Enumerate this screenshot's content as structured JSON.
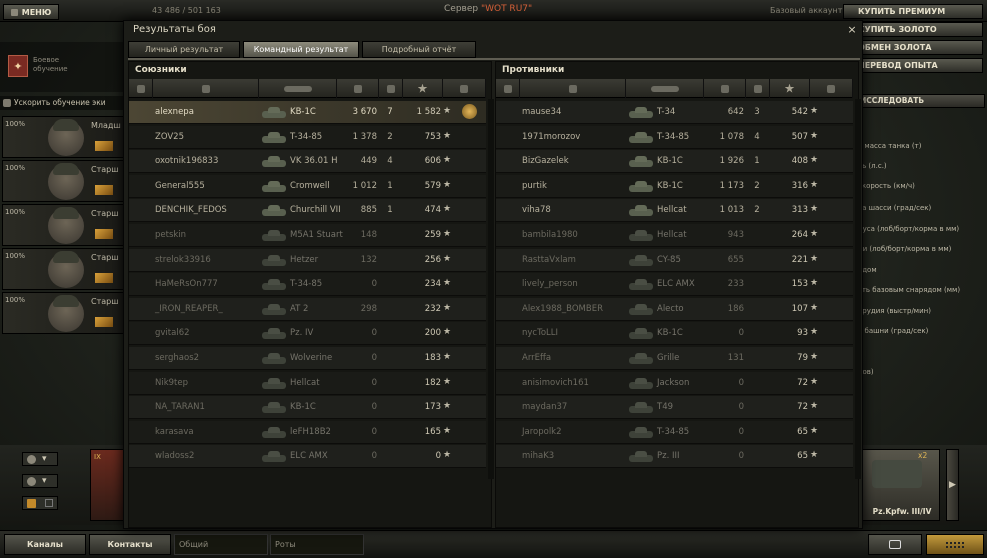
{
  "topbar": {
    "menu_label": "МЕНЮ",
    "stats": "43 486 / 501 163",
    "server_prefix": "Сервер ",
    "server_name": "\"WOT RU7\"",
    "account": "Базовый аккаунт",
    "buy_premium": "КУПИТЬ ПРЕМИУМ",
    "buy_gold": "КУПИТЬ ЗОЛОТО",
    "exchange_gold": "ОБМЕН ЗОЛОТА",
    "convert_xp": "ПЕРЕВОД ОПЫТА"
  },
  "training": {
    "title": "Боевое обучение",
    "accelerate": "Ускорить обучение эки"
  },
  "crew": [
    {
      "pct": "100%",
      "rank": "Младш"
    },
    {
      "pct": "100%",
      "rank": "Старш"
    },
    {
      "pct": "100%",
      "rank": "Старш"
    },
    {
      "pct": "100%",
      "rank": "Старш"
    },
    {
      "pct": "100%",
      "rank": "Старш"
    }
  ],
  "research_label": "ИССЛЕДОВАТЬ",
  "params": [
    "я масса танка (т)",
    "ть (л.с.)",
    "скорость (км/ч)",
    "та шасси (град/сек)",
    "пуса (лоб/борт/корма в мм)",
    "ни (лоб/борт/корма в мм)",
    "ядом",
    "сть базовым снарядом (мм)",
    "орудия (выстр/мин)",
    "а башни (град/сек)",
    "ров)"
  ],
  "carousel": {
    "tank_name": "Pz.Kpfw. III/IV",
    "tank_tier": "x2",
    "left_card_tier": "IX"
  },
  "bottom": {
    "channels": "Каналы",
    "contacts": "Контакты",
    "common": "Общий",
    "companies": "Роты"
  },
  "dialog": {
    "title": "Результаты боя",
    "close": "×",
    "tabs": [
      {
        "label": "Личный результат"
      },
      {
        "label": "Командный результат"
      },
      {
        "label": "Подробный отчёт"
      }
    ],
    "allies_title": "Союзники",
    "enemies_title": "Противники",
    "allies": [
      {
        "player": "alexnepa",
        "tank": "KB-1C",
        "damage": "3 670",
        "kills": "7",
        "xp": "1 582"
      },
      {
        "player": "ZOV25",
        "tank": "T-34-85",
        "damage": "1 378",
        "kills": "2",
        "xp": "753"
      },
      {
        "player": "oxotnik196833",
        "tank": "VK 36.01 H",
        "damage": "449",
        "kills": "4",
        "xp": "606"
      },
      {
        "player": "General555",
        "tank": "Cromwell",
        "damage": "1 012",
        "kills": "1",
        "xp": "579"
      },
      {
        "player": "DENCHIK_FEDOS",
        "tank": "Churchill VII",
        "damage": "885",
        "kills": "1",
        "xp": "474"
      },
      {
        "player": "petskin",
        "tank": "M5A1 Stuart",
        "damage": "148",
        "kills": "",
        "xp": "259"
      },
      {
        "player": "strelok33916",
        "tank": "Hetzer",
        "damage": "132",
        "kills": "",
        "xp": "256"
      },
      {
        "player": "HaMeRsOn777",
        "tank": "T-34-85",
        "damage": "0",
        "kills": "",
        "xp": "234"
      },
      {
        "player": "_IRON_REAPER_",
        "tank": "AT 2",
        "damage": "298",
        "kills": "",
        "xp": "232"
      },
      {
        "player": "gvital62",
        "tank": "Pz. IV",
        "damage": "0",
        "kills": "",
        "xp": "200"
      },
      {
        "player": "serghaos2",
        "tank": "Wolverine",
        "damage": "0",
        "kills": "",
        "xp": "183"
      },
      {
        "player": "Nik9tep",
        "tank": "Hellcat",
        "damage": "0",
        "kills": "",
        "xp": "182"
      },
      {
        "player": "NA_TARAN1",
        "tank": "KB-1C",
        "damage": "0",
        "kills": "",
        "xp": "173"
      },
      {
        "player": "karasava",
        "tank": "leFH18B2",
        "damage": "0",
        "kills": "",
        "xp": "165"
      },
      {
        "player": "wladoss2",
        "tank": "ELC AMX",
        "damage": "0",
        "kills": "",
        "xp": "0"
      }
    ],
    "enemies": [
      {
        "player": "mause34",
        "tank": "T-34",
        "damage": "642",
        "kills": "3",
        "xp": "542"
      },
      {
        "player": "1971morozov",
        "tank": "T-34-85",
        "damage": "1 078",
        "kills": "4",
        "xp": "507"
      },
      {
        "player": "BizGazelek",
        "tank": "KB-1C",
        "damage": "1 926",
        "kills": "1",
        "xp": "408"
      },
      {
        "player": "purtik",
        "tank": "KB-1C",
        "damage": "1 173",
        "kills": "2",
        "xp": "316"
      },
      {
        "player": "viha78",
        "tank": "Hellcat",
        "damage": "1 013",
        "kills": "2",
        "xp": "313"
      },
      {
        "player": "bambila1980",
        "tank": "Hellcat",
        "damage": "943",
        "kills": "",
        "xp": "264"
      },
      {
        "player": "RasttaVxlam",
        "tank": "CY-85",
        "damage": "655",
        "kills": "",
        "xp": "221"
      },
      {
        "player": "lively_person",
        "tank": "ELC AMX",
        "damage": "233",
        "kills": "",
        "xp": "153"
      },
      {
        "player": "Alex1988_BOMBER",
        "tank": "Alecto",
        "damage": "186",
        "kills": "",
        "xp": "107"
      },
      {
        "player": "nycToLLI",
        "tank": "KB-1C",
        "damage": "0",
        "kills": "",
        "xp": "93"
      },
      {
        "player": "ArrEffa",
        "tank": "Grille",
        "damage": "131",
        "kills": "",
        "xp": "79"
      },
      {
        "player": "anisimovich161",
        "tank": "Jackson",
        "damage": "0",
        "kills": "",
        "xp": "72"
      },
      {
        "player": "maydan37",
        "tank": "T49",
        "damage": "0",
        "kills": "",
        "xp": "72"
      },
      {
        "player": "Jaropolk2",
        "tank": "T-34-85",
        "damage": "0",
        "kills": "",
        "xp": "65"
      },
      {
        "player": "mihaK3",
        "tank": "Pz. III",
        "damage": "0",
        "kills": "",
        "xp": "65"
      }
    ],
    "star_glyph": "★"
  },
  "colors": {
    "accent_orange": "#d9623a",
    "gold": "#e0b655"
  }
}
